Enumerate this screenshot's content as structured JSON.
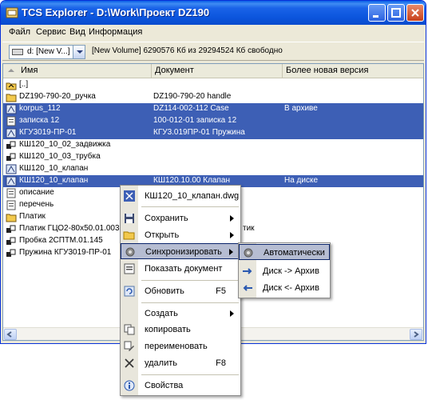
{
  "window": {
    "title": "TCS Explorer - D:\\Work\\Проект DZ190"
  },
  "menubar": [
    {
      "label": "Файл"
    },
    {
      "label": "Сервис"
    },
    {
      "label": "Вид"
    },
    {
      "label": "Информация"
    }
  ],
  "toolbar": {
    "drive_value": "d: [New V...]",
    "volume_info": "[New Volume]  6290576 Кб из 29294524 Кб свободно"
  },
  "list": {
    "columns": [
      "Имя",
      "Документ",
      "Более новая версия"
    ],
    "rows": [
      {
        "name": "[..]",
        "doc": "",
        "newer": "",
        "selected": false,
        "icon": "parent-folder-icon"
      },
      {
        "name": "DZ190-790-20_ручка",
        "doc": "DZ190-790-20 handle",
        "newer": "",
        "selected": false,
        "icon": "folder-icon"
      },
      {
        "name": "korpus_112",
        "doc": "DZ114-002-112 Case",
        "newer": "В архиве",
        "selected": true,
        "icon": "drawing-icon"
      },
      {
        "name": "записка 12",
        "doc": "100-012-01 записка 12",
        "newer": "",
        "selected": true,
        "icon": "document-icon"
      },
      {
        "name": "КГУ3019-ПР-01",
        "doc": "КГУ3.019ПР-01 Пружина",
        "newer": "",
        "selected": true,
        "icon": "drawing-icon"
      },
      {
        "name": "КШ120_10_02_задвижка",
        "doc": "",
        "newer": "",
        "selected": false,
        "icon": "assembly-icon"
      },
      {
        "name": "КШ120_10_03_трубка",
        "doc": "",
        "newer": "",
        "selected": false,
        "icon": "assembly-icon"
      },
      {
        "name": "КШ120_10_клапан",
        "doc": "",
        "newer": "",
        "selected": false,
        "icon": "drawing-icon"
      },
      {
        "name": "КШ120_10_клапан",
        "doc": "КШ120.10.00 Клапан",
        "newer": "На диске",
        "selected": true,
        "icon": "drawing-icon"
      },
      {
        "name": "описание",
        "doc": "",
        "newer": "",
        "selected": false,
        "icon": "document-icon"
      },
      {
        "name": "перечень",
        "doc": "",
        "newer": "",
        "selected": false,
        "icon": "document-icon"
      },
      {
        "name": "Платик",
        "doc": "",
        "newer": "",
        "selected": false,
        "icon": "folder-icon"
      },
      {
        "name": "Платик ГЦО2-80х50.01.003",
        "doc": "тик",
        "newer": "",
        "selected": false,
        "icon": "assembly-icon"
      },
      {
        "name": "Пробка 2СПТМ.01.145",
        "doc": "",
        "newer": "",
        "selected": false,
        "icon": "assembly-icon"
      },
      {
        "name": "Пружина КГУ3019-ПР-01",
        "doc": "",
        "newer": "",
        "selected": false,
        "icon": "assembly-icon"
      }
    ]
  },
  "context_menu": {
    "header": "КШ120_10_клапан.dwg",
    "save": "Сохранить",
    "open": "Открыть",
    "sync": "Синхронизировать",
    "show_doc": "Показать документ",
    "refresh": "Обновить",
    "refresh_key": "F5",
    "create": "Создать",
    "copy": "копировать",
    "rename": "переименовать",
    "delete": "удалить",
    "delete_key": "F8",
    "properties": "Свойства"
  },
  "sync_submenu": {
    "auto": "Автоматически",
    "to_archive": "Диск -> Архив",
    "from_archive": "Диск <- Архив"
  },
  "colors": {
    "title_bar": "#0a5ee6",
    "selection": "#3d5fb5",
    "menu_hover": "#b6bdd2"
  }
}
